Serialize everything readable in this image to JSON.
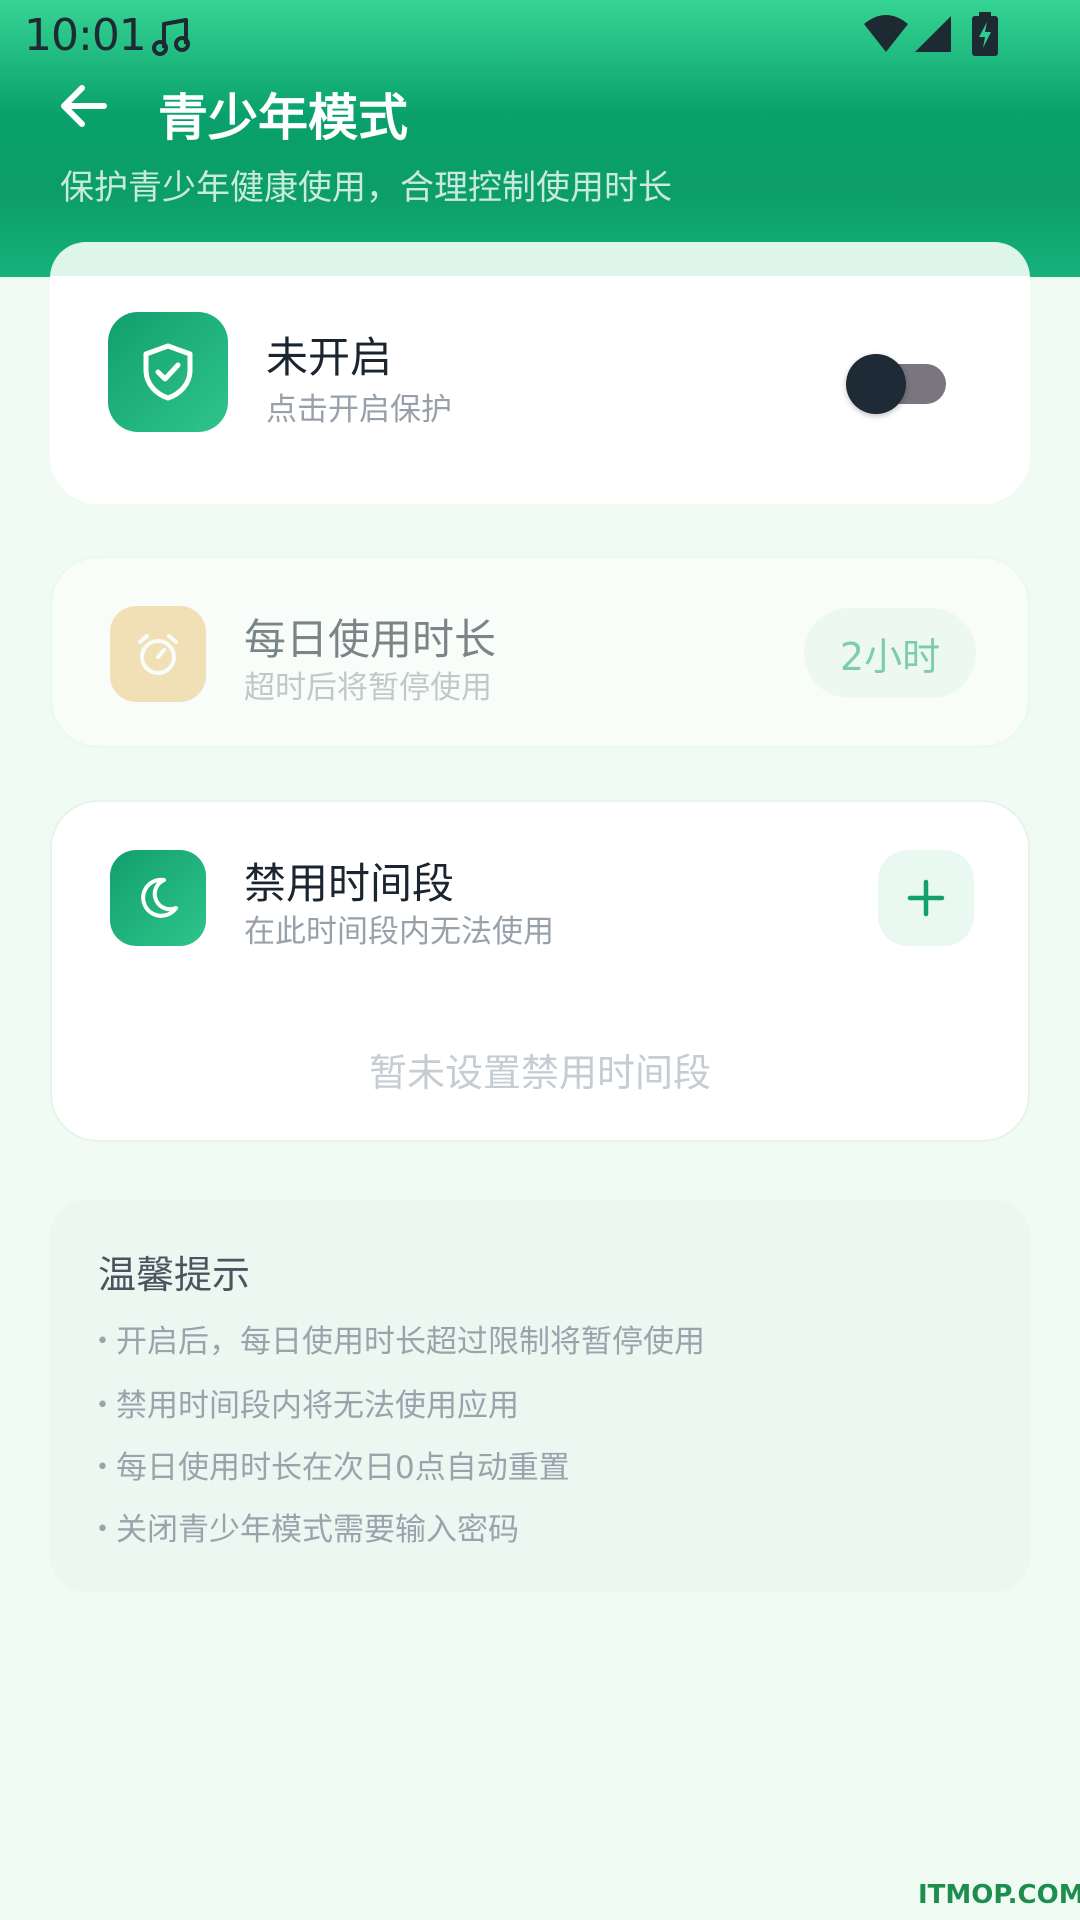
{
  "status_bar": {
    "time": "10:01",
    "icons": [
      "music-note-icon",
      "wifi-icon",
      "signal-icon",
      "battery-charging-icon"
    ]
  },
  "header": {
    "title": "青少年模式",
    "subtitle": "保护青少年健康使用，合理控制使用时长"
  },
  "protection": {
    "title": "未开启",
    "subtitle": "点击开启保护",
    "enabled": false,
    "icon": "shield-check-icon"
  },
  "daily_usage": {
    "title": "每日使用时长",
    "subtitle": "超时后将暂停使用",
    "value": "2小时",
    "icon": "alarm-clock-icon"
  },
  "ban_period": {
    "title": "禁用时间段",
    "subtitle": "在此时间段内无法使用",
    "empty_text": "暂未设置禁用时间段",
    "icon": "moon-icon",
    "add_icon": "plus-icon"
  },
  "tips": {
    "title": "温馨提示",
    "items": [
      "开启后，每日使用时长超过限制将暂停使用",
      "禁用时间段内将无法使用应用",
      "每日使用时长在次日0点自动重置",
      "关闭青少年模式需要输入密码"
    ]
  },
  "watermark": "ITMOP.COM",
  "colors": {
    "accent": "#0C9E69",
    "accent_light": "#36D494",
    "clock_icon_bg": "#F2CB82",
    "background": "#F0FBF4"
  }
}
